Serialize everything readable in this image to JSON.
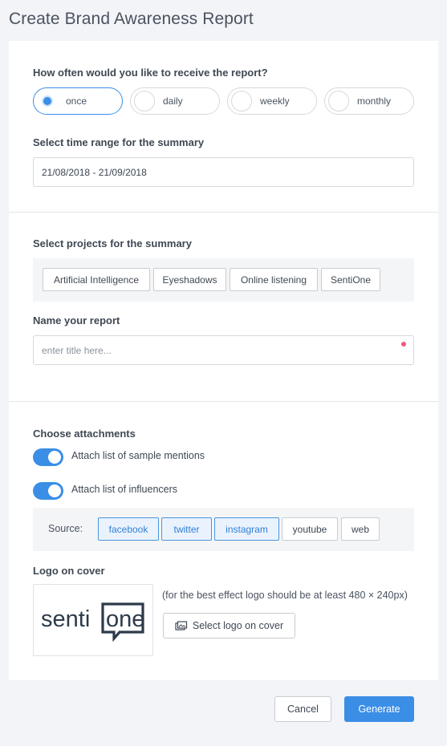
{
  "page": {
    "title": "Create Brand Awareness Report"
  },
  "frequency": {
    "label": "How often would you like to receive the report?",
    "options": [
      "once",
      "daily",
      "weekly",
      "monthly"
    ],
    "selected": "once"
  },
  "time_range": {
    "label": "Select time range for the summary",
    "value": "21/08/2018 - 21/09/2018"
  },
  "projects": {
    "label": "Select projects for the summary",
    "items": [
      "Artificial Intelligence",
      "Eyeshadows",
      "Online listening",
      "SentiOne"
    ]
  },
  "report_name": {
    "label": "Name your report",
    "placeholder": "enter title here..."
  },
  "attachments": {
    "label": "Choose attachments",
    "toggles": [
      {
        "label": "Attach list of sample mentions",
        "on": true
      },
      {
        "label": "Attach list of influencers",
        "on": true
      }
    ],
    "source_label": "Source:",
    "sources": [
      {
        "label": "facebook",
        "active": true
      },
      {
        "label": "twitter",
        "active": true
      },
      {
        "label": "instagram",
        "active": true
      },
      {
        "label": "youtube",
        "active": false
      },
      {
        "label": "web",
        "active": false
      }
    ]
  },
  "logo": {
    "label": "Logo on cover",
    "brand_text_left": "senti",
    "brand_text_right": "one",
    "hint": "(for the best effect logo should be at least 480 × 240px)",
    "select_button": "Select logo on cover",
    "icon": "image-upload-icon"
  },
  "footer": {
    "cancel": "Cancel",
    "generate": "Generate"
  },
  "colors": {
    "accent": "#3a8ee6",
    "required": "#f25a7e",
    "logo_dark": "#2d3a4b"
  }
}
